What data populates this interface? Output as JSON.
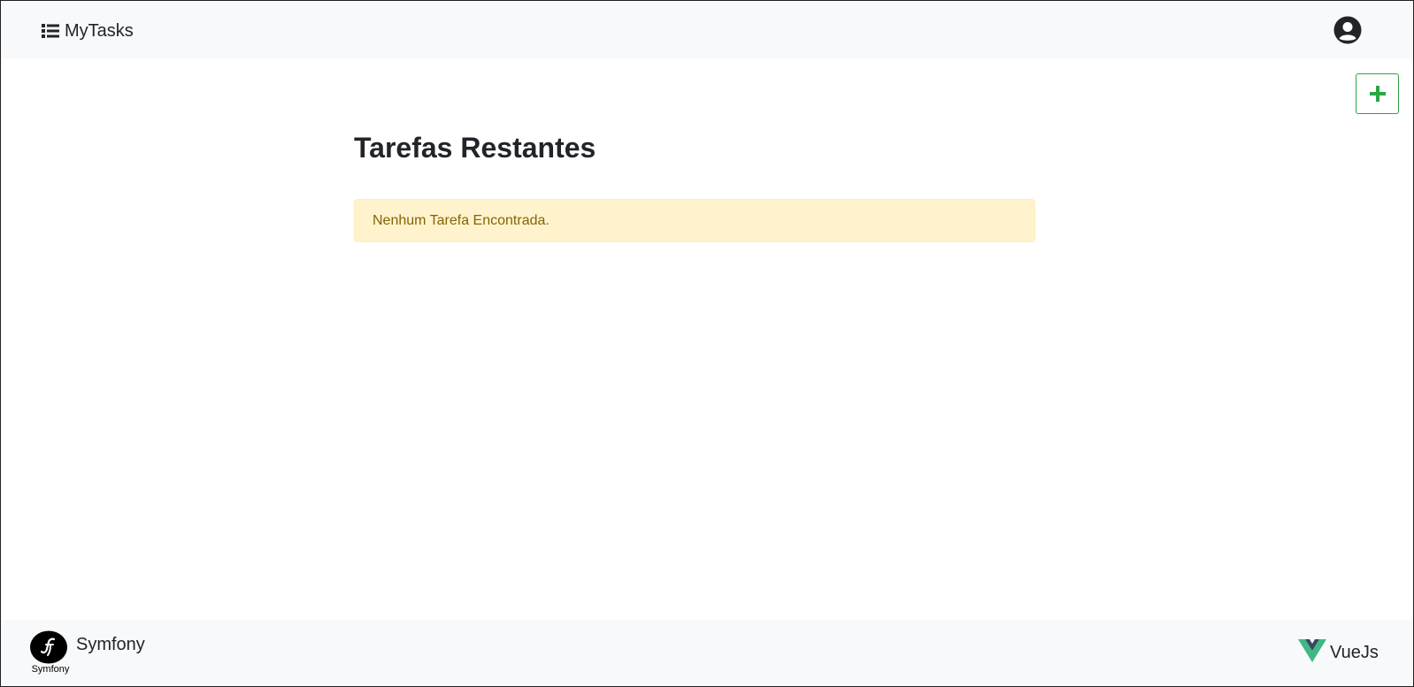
{
  "navbar": {
    "brand_label": "MyTasks",
    "brand_icon": "list-icon",
    "user_icon": "user-circle-icon"
  },
  "toolbar": {
    "add_icon": "plus-icon",
    "accent_color": "#28a745"
  },
  "main": {
    "title": "Tarefas Restantes",
    "empty_message": "Nenhum Tarefa Encontrada.",
    "alert_color": "#fff3cd"
  },
  "footer": {
    "symfony_label": "Symfony",
    "symfony_logo_caption": "Symfony",
    "vue_label": "VueJs"
  }
}
